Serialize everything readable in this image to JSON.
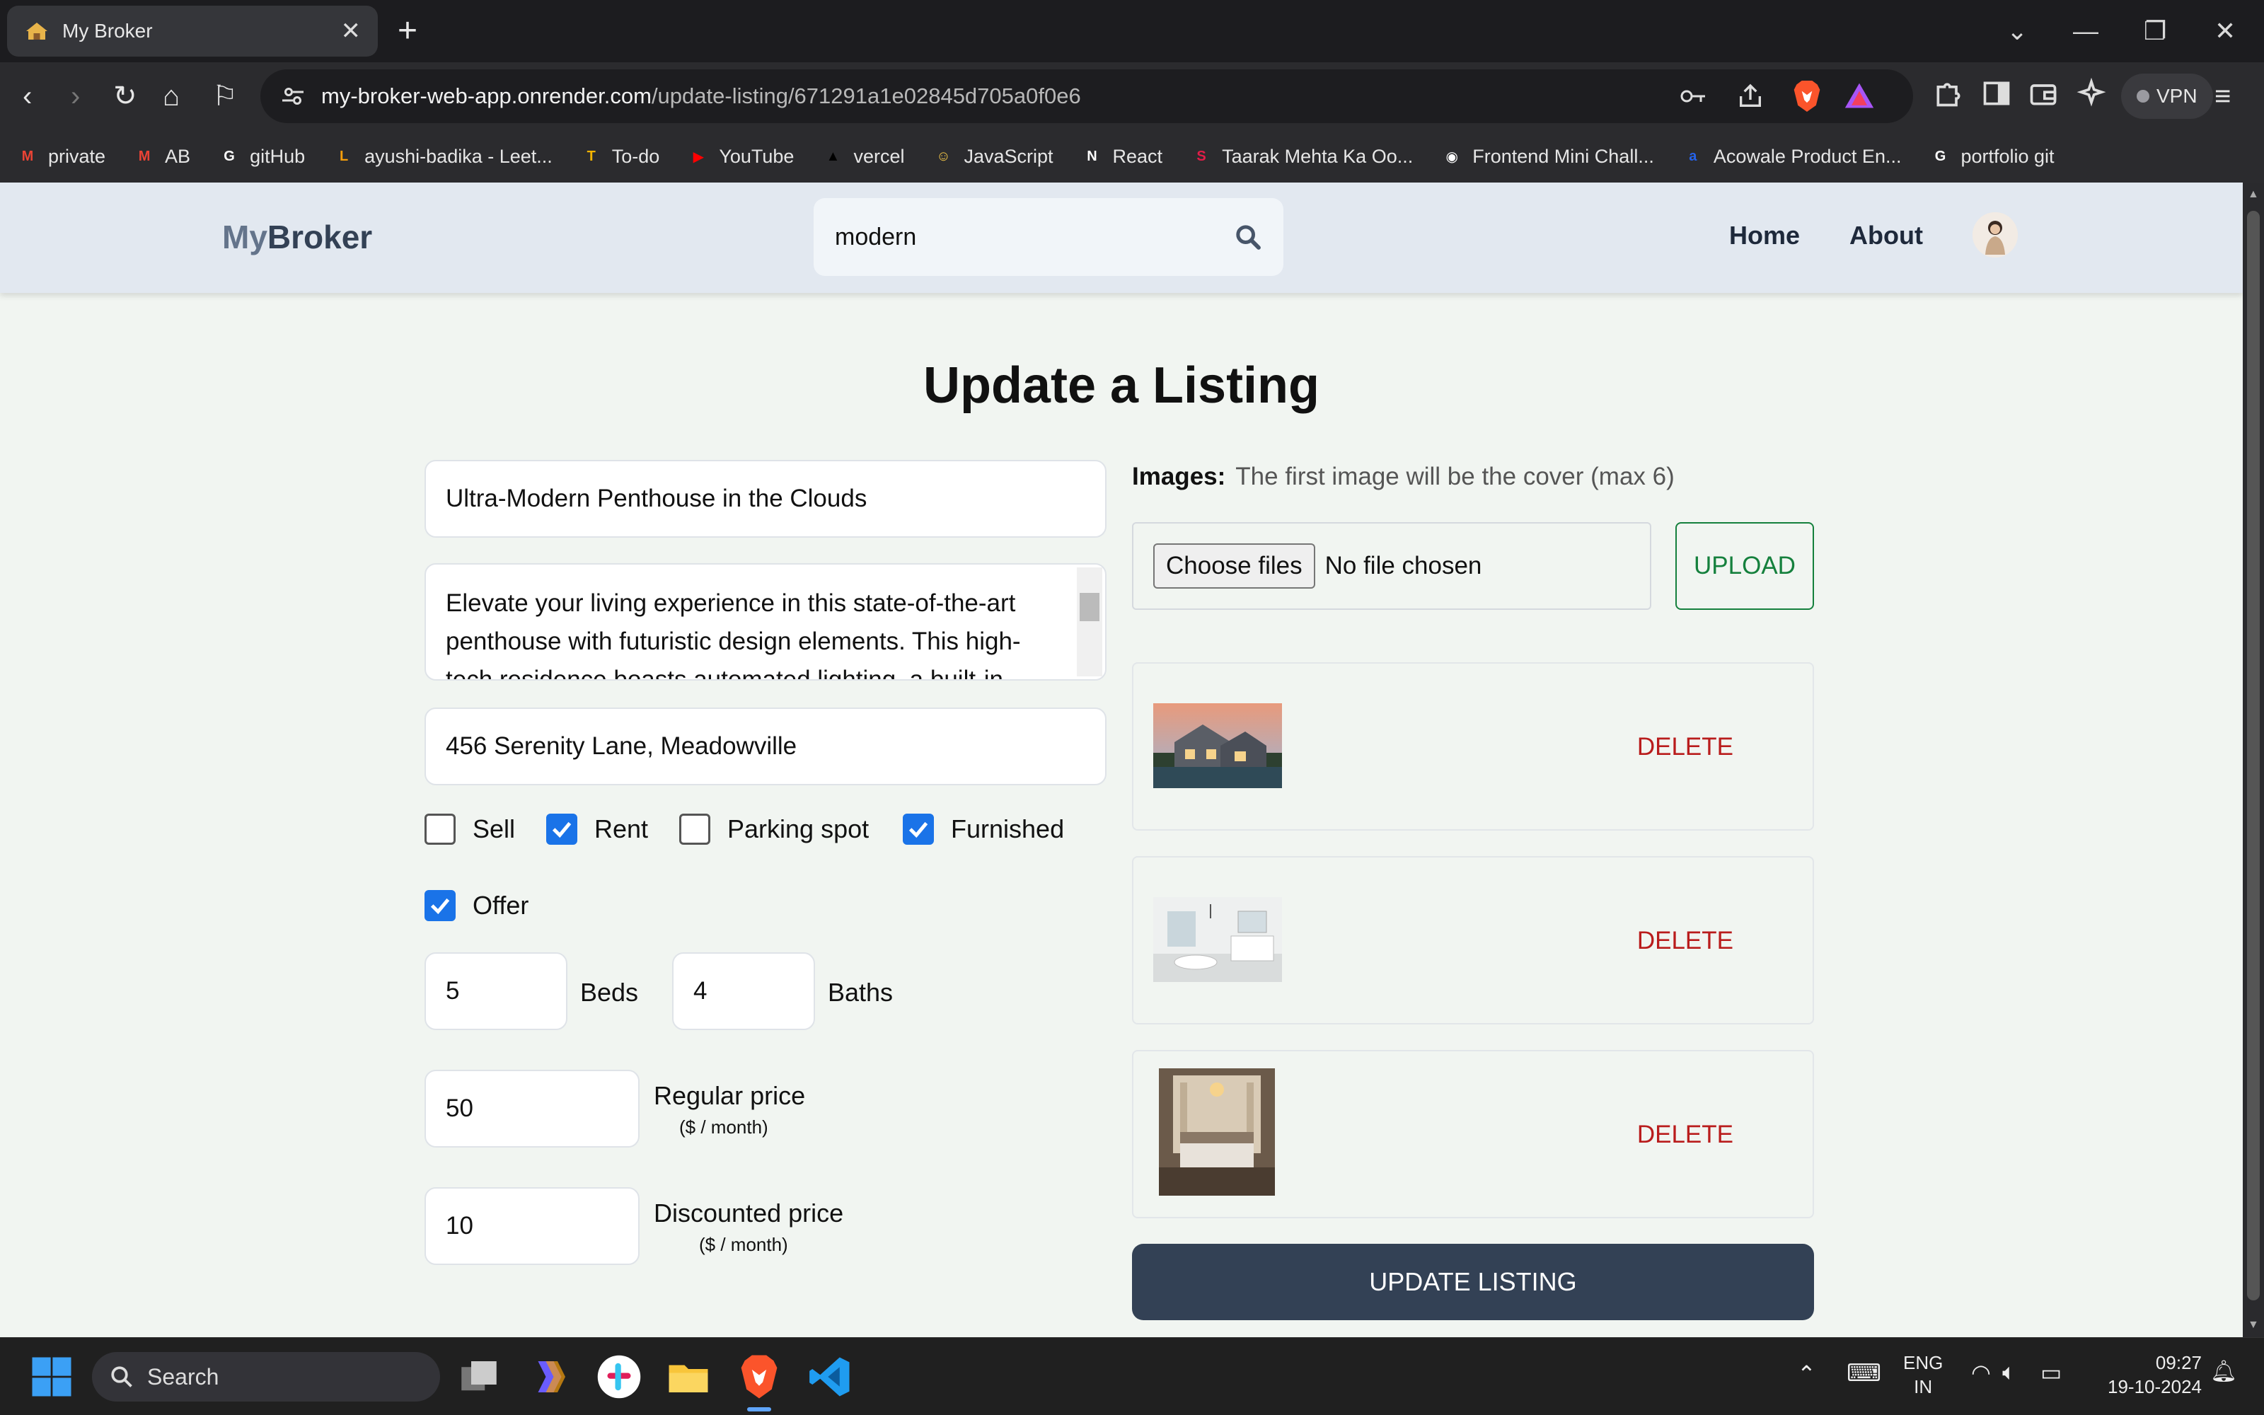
{
  "browser": {
    "tab_title": "My Broker",
    "url_domain": "my-broker-web-app.onrender.com",
    "url_path": "/update-listing/671291a1e02845d705a0f0e6",
    "vpn_label": "VPN",
    "bookmarks": [
      {
        "label": "private",
        "icon": "gmail-icon",
        "color": "#ea4335",
        "glyph": "M"
      },
      {
        "label": "AB",
        "icon": "gmail-icon",
        "color": "#ea4335",
        "glyph": "M"
      },
      {
        "label": "gitHub",
        "icon": "github-icon",
        "color": "#ffffff",
        "glyph": "G"
      },
      {
        "label": "ayushi-badika - Leet...",
        "icon": "leetcode-icon",
        "color": "#f59e0b",
        "glyph": "L"
      },
      {
        "label": "To-do",
        "icon": "classroom-icon",
        "color": "#f4b400",
        "glyph": "T"
      },
      {
        "label": "YouTube",
        "icon": "youtube-icon",
        "color": "#ff0000",
        "glyph": "▶"
      },
      {
        "label": "vercel",
        "icon": "vercel-icon",
        "color": "#000000",
        "glyph": "▲"
      },
      {
        "label": "JavaScript",
        "icon": "emoji-icon",
        "color": "#f7c948",
        "glyph": "☺"
      },
      {
        "label": "React",
        "icon": "notion-icon",
        "color": "#ffffff",
        "glyph": "N"
      },
      {
        "label": "Taarak Mehta Ka Oo...",
        "icon": "sonyliv-icon",
        "color": "#e11d48",
        "glyph": "S"
      },
      {
        "label": "Frontend Mini Chall...",
        "icon": "page-icon",
        "color": "#ffffff",
        "glyph": "◉"
      },
      {
        "label": "Acowale Product En...",
        "icon": "acowale-icon",
        "color": "#2563eb",
        "glyph": "a"
      },
      {
        "label": "portfolio git",
        "icon": "github-icon",
        "color": "#ffffff",
        "glyph": "G"
      }
    ]
  },
  "header": {
    "logo_part1": "My",
    "logo_part2": "Broker",
    "search_value": "modern",
    "nav": {
      "home": "Home",
      "about": "About"
    }
  },
  "form": {
    "title": "Update a Listing",
    "name": "Ultra-Modern Penthouse in the Clouds",
    "description": "Elevate your living experience in this state-of-the-art penthouse with futuristic design elements. This high-tech residence boasts automated lighting, a built-in",
    "address": "456 Serenity Lane, Meadowville",
    "options": [
      {
        "label": "Sell",
        "checked": false
      },
      {
        "label": "Rent",
        "checked": true
      },
      {
        "label": "Parking spot",
        "checked": false
      },
      {
        "label": "Furnished",
        "checked": true
      },
      {
        "label": "Offer",
        "checked": true
      }
    ],
    "beds": "5",
    "beds_label": "Beds",
    "baths": "4",
    "baths_label": "Baths",
    "regular_price": "50",
    "regular_price_label": "Regular price",
    "regular_price_unit": "($ / month)",
    "discounted_price": "10",
    "discounted_price_label": "Discounted price",
    "discounted_price_unit": "($ / month)"
  },
  "images": {
    "label": "Images:",
    "hint": "The first image will be the cover (max 6)",
    "choose_files": "Choose files",
    "no_file": "No file chosen",
    "upload": "UPLOAD",
    "items": [
      {
        "alt": "house exterior",
        "delete": "DELETE"
      },
      {
        "alt": "bathroom",
        "delete": "DELETE"
      },
      {
        "alt": "bedroom",
        "delete": "DELETE"
      }
    ],
    "submit": "UPDATE LISTING"
  },
  "taskbar": {
    "search_placeholder": "Search",
    "lang_line1": "ENG",
    "lang_line2": "IN",
    "time": "09:27",
    "date": "19-10-2024"
  },
  "colors": {
    "accent_blue": "#1a73e8",
    "upload_green": "#15803d",
    "delete_red": "#b91c1c",
    "button_slate": "#334155"
  }
}
